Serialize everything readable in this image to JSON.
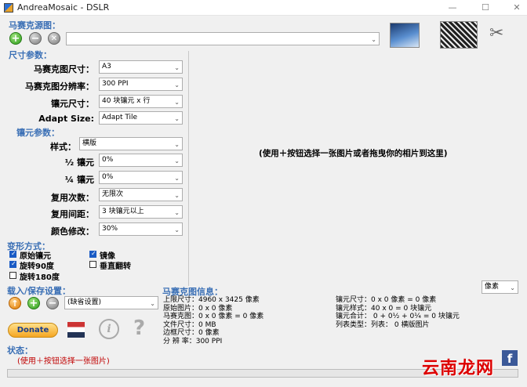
{
  "window": {
    "title": "AndreaMosaic - DSLR",
    "minimize": "—",
    "maximize": "☐",
    "close": "✕"
  },
  "source": {
    "heading": "马赛克源图：",
    "path_value": ""
  },
  "size": {
    "heading": "尺寸参数：",
    "rows": [
      {
        "label": "马赛克图尺寸：",
        "value": "A3"
      },
      {
        "label": "马赛克图分辨率：",
        "value": "300 PPI"
      },
      {
        "label": "镶元尺寸：",
        "value": "40 块镶元 x 行"
      },
      {
        "label": "Adapt Size:",
        "value": "Adapt Tile"
      }
    ]
  },
  "tile": {
    "heading": "镶元参数：",
    "rows": [
      {
        "label": "样式：",
        "value": "横版"
      },
      {
        "label": "½ 镶元",
        "value": "0%"
      },
      {
        "label": "¼ 镶元",
        "value": "0%"
      },
      {
        "label": "复用次数：",
        "value": "无限次"
      },
      {
        "label": "复用间距：",
        "value": "3 块镶元以上"
      },
      {
        "label": "颜色修改：",
        "value": "30%"
      }
    ]
  },
  "transform": {
    "heading": "变形方式：",
    "options": [
      {
        "label": "原始镶元",
        "checked": true
      },
      {
        "label": "镜像",
        "checked": true
      },
      {
        "label": "旋转90度",
        "checked": true
      },
      {
        "label": "垂直翻转",
        "checked": false
      },
      {
        "label": "旋转180度",
        "checked": false
      }
    ]
  },
  "load_save": {
    "heading": "载入/保存设置：",
    "preset": "(缺省设置)"
  },
  "donate_label": "Donate",
  "status": {
    "heading": "状态：",
    "message": "(使用＋按钮选择一张图片)"
  },
  "preview_hint": "(使用＋按钮选择一张图片或者拖曳你的相片到这里)",
  "unit_select": "像素",
  "info": {
    "heading": "马赛克图信息：",
    "left": [
      "上限尺寸：4960 x 3425 像素",
      "原始图片：0 x 0 像素",
      "马赛克图：0 x 0 像素 = 0 像素",
      "文件尺寸：0 MB",
      "边框尺寸：0 像素",
      "分 辨 率：300 PPI"
    ],
    "right": [
      "镶元尺寸：0 x 0 像素 = 0 像素",
      "镶元样式：40 x 0 = 0 块镶元",
      "镶元合计：  0 + 0½ + 0¼ = 0 块镶元",
      "列表类型：列表：  0 横版图片"
    ]
  },
  "watermark": "云南龙网",
  "colors": {
    "accent": "#3a6fb5",
    "status": "#c00000"
  }
}
